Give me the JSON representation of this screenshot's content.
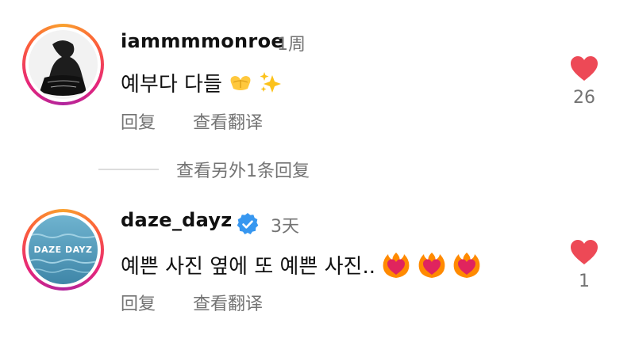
{
  "comments": [
    {
      "username": "iammmmonroe",
      "time": "1周",
      "text": "예부다 다들",
      "actions": {
        "reply": "回复",
        "translate": "查看翻译"
      },
      "likes": "26",
      "emoji": [
        "heart-hands",
        "sparkles"
      ]
    },
    {
      "username": "daze_dayz",
      "verified": true,
      "time": "3天",
      "text": "예쁜 사진 옆에 또 예쁜 사진..",
      "actions": {
        "reply": "回复",
        "translate": "查看翻译"
      },
      "likes": "1",
      "avatar_text": "DAZE DAYZ",
      "emoji": [
        "heart-on-fire",
        "heart-on-fire",
        "heart-on-fire"
      ]
    }
  ],
  "more_replies": "查看另外1条回复",
  "colors": {
    "like": "#ed4956",
    "muted": "#737373",
    "verified": "#3797f0"
  }
}
